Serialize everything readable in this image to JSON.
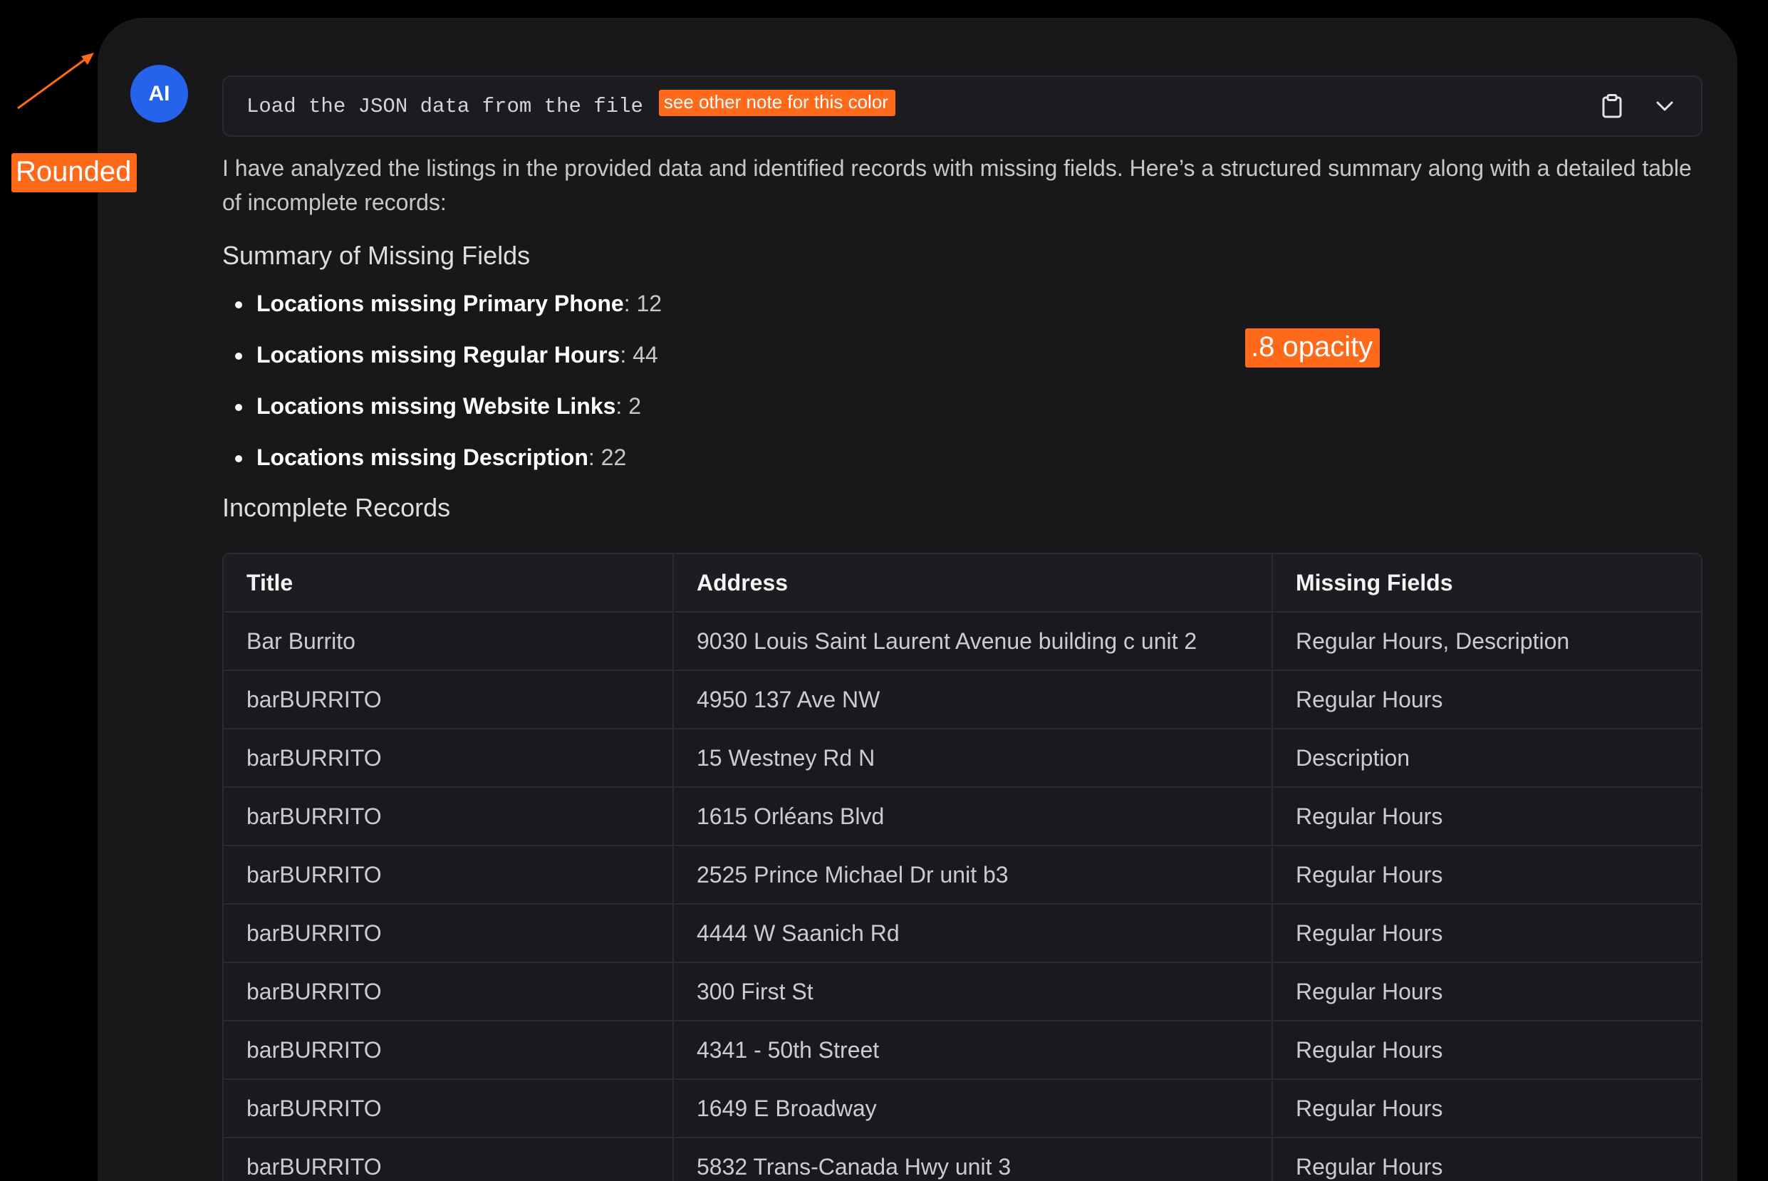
{
  "avatar": {
    "initials": "AI",
    "color": "#2563eb"
  },
  "prompt": {
    "text": "Load the JSON data from the file",
    "copy_icon": "clipboard-icon",
    "expand_icon": "chevron-down-icon"
  },
  "message": {
    "intro": "I have analyzed the listings in the provided data and identified records with missing fields. Here’s a structured summary along with a detailed table of incomplete records:",
    "summary_heading": "Summary of Missing Fields",
    "summary_items": [
      {
        "label": "Locations missing Primary Phone",
        "value": ": 12"
      },
      {
        "label": "Locations missing Regular Hours",
        "value": ": 44"
      },
      {
        "label": "Locations missing Website Links",
        "value": ": 2"
      },
      {
        "label": "Locations missing Description",
        "value": ": 22"
      }
    ],
    "records_heading": "Incomplete Records"
  },
  "table": {
    "headers": [
      "Title",
      "Address",
      "Missing Fields"
    ],
    "rows": [
      [
        "Bar Burrito",
        "9030 Louis Saint Laurent Avenue building c unit 2",
        "Regular Hours, Description"
      ],
      [
        "barBURRITO",
        "4950 137 Ave NW",
        "Regular Hours"
      ],
      [
        "barBURRITO",
        "15 Westney Rd N",
        "Description"
      ],
      [
        "barBURRITO",
        "1615 Orléans Blvd",
        "Regular Hours"
      ],
      [
        "barBURRITO",
        "2525 Prince Michael Dr unit b3",
        "Regular Hours"
      ],
      [
        "barBURRITO",
        "4444 W Saanich Rd",
        "Regular Hours"
      ],
      [
        "barBURRITO",
        "300 First St",
        "Regular Hours"
      ],
      [
        "barBURRITO",
        "4341 - 50th Street",
        "Regular Hours"
      ],
      [
        "barBURRITO",
        "1649 E Broadway",
        "Regular Hours"
      ],
      [
        "barBURRITO",
        "5832 Trans-Canada Hwy unit 3",
        "Regular Hours"
      ]
    ]
  },
  "annotations": {
    "rounded": "Rounded",
    "color_note": "see other note for this color",
    "opacity": ".8 opacity",
    "accent": "#ff6a1a"
  },
  "colors": {
    "background": "#000000",
    "card": "#18181b",
    "border": "#2a2a2f",
    "text": "#f4f4f5"
  }
}
